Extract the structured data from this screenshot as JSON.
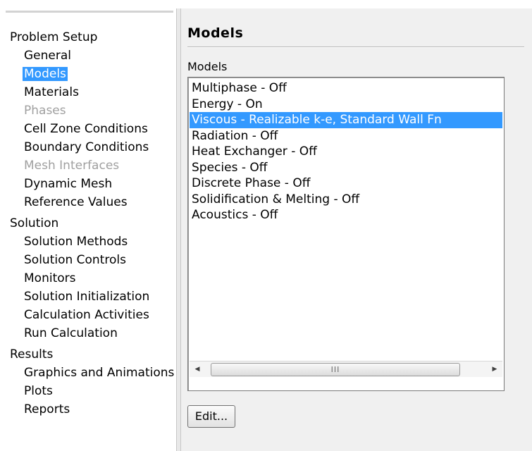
{
  "nav": {
    "sections": [
      {
        "title": "Problem Setup",
        "items": [
          {
            "label": "General",
            "state": "normal"
          },
          {
            "label": "Models",
            "state": "selected"
          },
          {
            "label": "Materials",
            "state": "normal"
          },
          {
            "label": "Phases",
            "state": "disabled"
          },
          {
            "label": "Cell Zone Conditions",
            "state": "normal"
          },
          {
            "label": "Boundary Conditions",
            "state": "normal"
          },
          {
            "label": "Mesh Interfaces",
            "state": "disabled"
          },
          {
            "label": "Dynamic Mesh",
            "state": "normal"
          },
          {
            "label": "Reference Values",
            "state": "normal"
          }
        ]
      },
      {
        "title": "Solution",
        "items": [
          {
            "label": "Solution Methods",
            "state": "normal"
          },
          {
            "label": "Solution Controls",
            "state": "normal"
          },
          {
            "label": "Monitors",
            "state": "normal"
          },
          {
            "label": "Solution Initialization",
            "state": "normal"
          },
          {
            "label": "Calculation Activities",
            "state": "normal"
          },
          {
            "label": "Run Calculation",
            "state": "normal"
          }
        ]
      },
      {
        "title": "Results",
        "items": [
          {
            "label": "Graphics and Animations",
            "state": "normal"
          },
          {
            "label": "Plots",
            "state": "normal"
          },
          {
            "label": "Reports",
            "state": "normal"
          }
        ]
      }
    ]
  },
  "panel": {
    "title": "Models",
    "group_label": "Models",
    "models": [
      {
        "label": "Multiphase - Off",
        "selected": false
      },
      {
        "label": "Energy - On",
        "selected": false
      },
      {
        "label": "Viscous - Realizable k-e, Standard Wall Fn",
        "selected": true
      },
      {
        "label": "Radiation - Off",
        "selected": false
      },
      {
        "label": "Heat Exchanger - Off",
        "selected": false
      },
      {
        "label": "Species - Off",
        "selected": false
      },
      {
        "label": "Discrete Phase - Off",
        "selected": false
      },
      {
        "label": "Solidification & Melting - Off",
        "selected": false
      },
      {
        "label": "Acoustics - Off",
        "selected": false
      }
    ],
    "scrollbar": {
      "left_arrow": "◀",
      "right_arrow": "▶",
      "grip": "III"
    },
    "edit_button": "Edit..."
  },
  "colors": {
    "selection": "#3399ff",
    "panel_bg": "#f0f0f0",
    "disabled_text": "#a0a0a0"
  }
}
